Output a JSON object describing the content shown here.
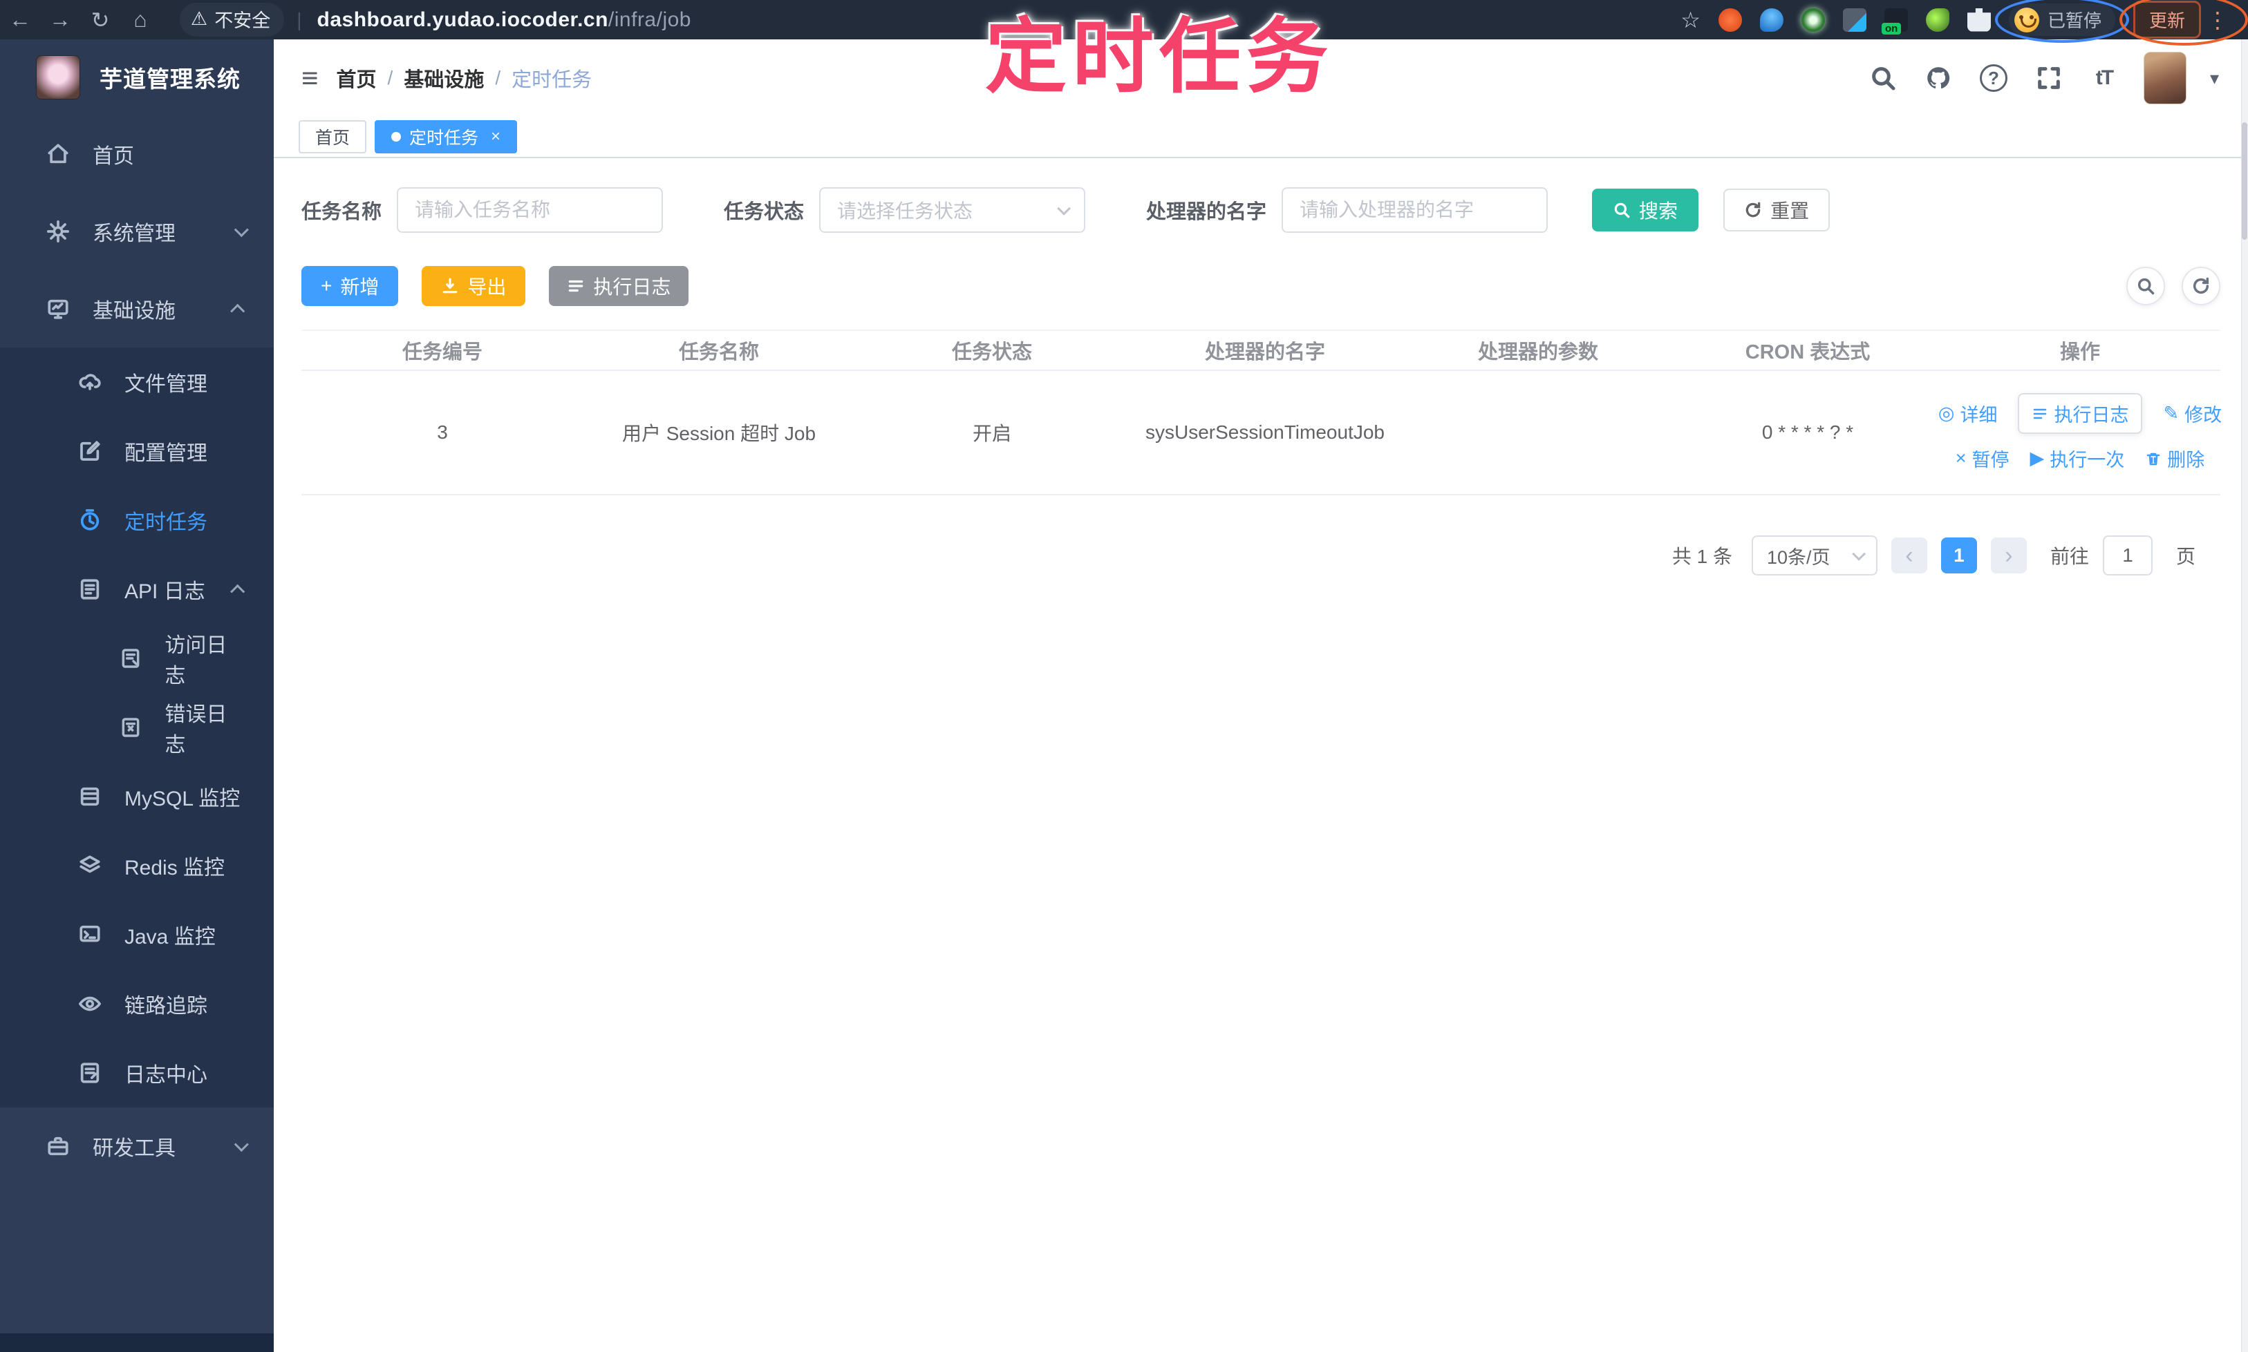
{
  "annotation": {
    "title": "定时任务"
  },
  "browser": {
    "security_label": "不安全",
    "url_host": "dashboard.yudao.iocoder.cn",
    "url_path": "/infra/job",
    "extension_badge": "on",
    "paused_label": "已暂停",
    "update_label": "更新"
  },
  "icons": {
    "back": "←",
    "forward": "→",
    "reload": "↻",
    "home": "⌂",
    "warning": "⚠",
    "star": "☆",
    "dots": "⋮",
    "caret_down": "▾",
    "menu_fold": "≡",
    "slash": "/",
    "plus": "+",
    "close": "×",
    "prev": "‹",
    "next": "›",
    "detail": "◎",
    "edit": "✎",
    "pause": "×",
    "run_once": "▶",
    "font_size": "tT",
    "question": "?"
  },
  "sidebar": {
    "title": "芋道管理系统",
    "items": [
      {
        "label": "首页"
      },
      {
        "label": "系统管理"
      },
      {
        "label": "基础设施",
        "children": [
          {
            "label": "文件管理"
          },
          {
            "label": "配置管理"
          },
          {
            "label": "定时任务"
          },
          {
            "label": "API 日志",
            "children": [
              {
                "label": "访问日志"
              },
              {
                "label": "错误日志"
              }
            ]
          },
          {
            "label": "MySQL 监控"
          },
          {
            "label": "Redis 监控"
          },
          {
            "label": "Java 监控"
          },
          {
            "label": "链路追踪"
          },
          {
            "label": "日志中心"
          }
        ]
      },
      {
        "label": "研发工具"
      }
    ]
  },
  "header": {
    "breadcrumb": [
      "首页",
      "基础设施",
      "定时任务"
    ]
  },
  "tabs": [
    {
      "label": "首页"
    },
    {
      "label": "定时任务"
    }
  ],
  "filters": {
    "name_label": "任务名称",
    "name_placeholder": "请输入任务名称",
    "status_label": "任务状态",
    "status_placeholder": "请选择任务状态",
    "handler_label": "处理器的名字",
    "handler_placeholder": "请输入处理器的名字",
    "search_label": "搜索",
    "reset_label": "重置"
  },
  "toolbar": {
    "add_label": "新增",
    "export_label": "导出",
    "job_log_label": "执行日志"
  },
  "table": {
    "columns": [
      "任务编号",
      "任务名称",
      "任务状态",
      "处理器的名字",
      "处理器的参数",
      "CRON 表达式",
      "操作"
    ],
    "rows": [
      {
        "id": "3",
        "name": "用户 Session 超时 Job",
        "status": "开启",
        "handler": "sysUserSessionTimeoutJob",
        "param": "",
        "cron": "0 * * * * ? *"
      }
    ],
    "actions": {
      "detail": "详细",
      "log": "执行日志",
      "edit": "修改",
      "pause": "暂停",
      "run_once": "执行一次",
      "delete": "删除"
    }
  },
  "pagination": {
    "total": "共 1 条",
    "page_size": "10条/页",
    "page": "1",
    "goto_label": "前往",
    "goto_value": "1",
    "unit_label": "页"
  },
  "colors": {
    "accent": "#409eff",
    "search_teal": "#2abda4",
    "export_orange": "#fbb116",
    "info_gray": "#909399",
    "annotation_pink": "#f4426b"
  }
}
